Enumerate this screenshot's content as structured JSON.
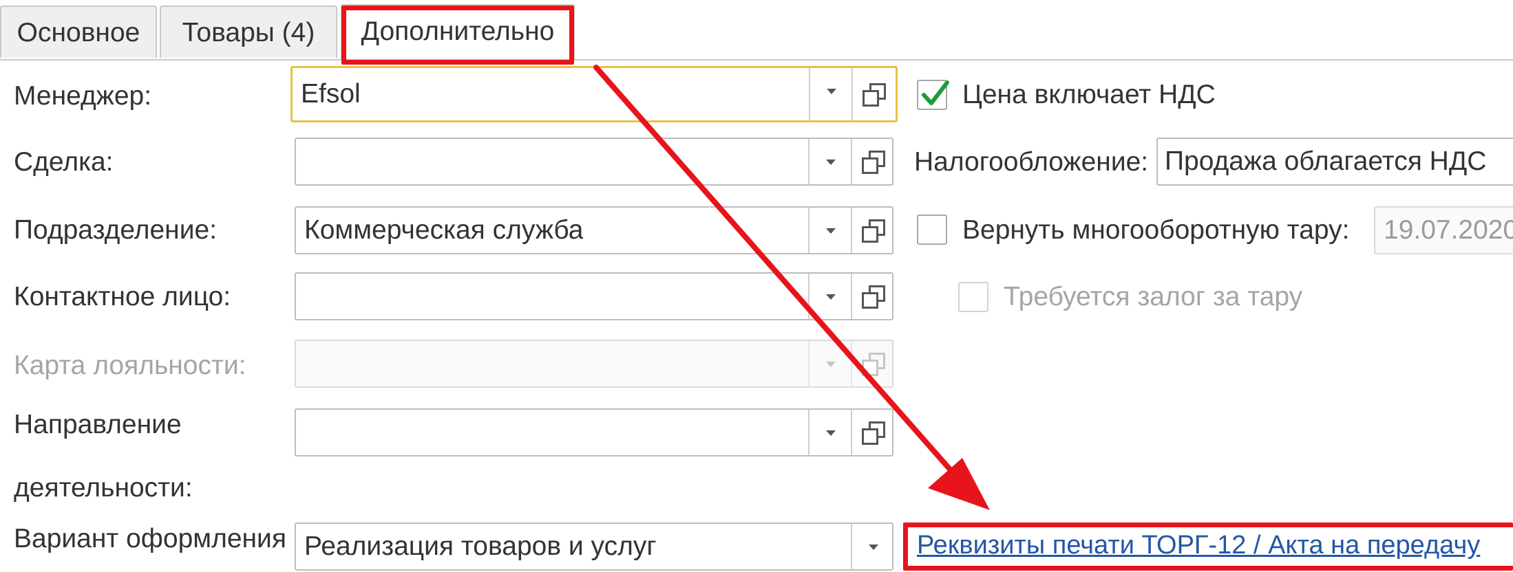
{
  "tabs": [
    {
      "label": "Основное",
      "active": false
    },
    {
      "label": "Товары (4)",
      "active": false
    },
    {
      "label": "Дополнительно",
      "active": true
    }
  ],
  "form": {
    "manager": {
      "label": "Менеджер:",
      "value": "Efsol"
    },
    "deal": {
      "label": "Сделка:",
      "value": ""
    },
    "department": {
      "label": "Подразделение:",
      "value": "Коммерческая служба"
    },
    "contact": {
      "label": "Контактное лицо:",
      "value": ""
    },
    "loyalty_card": {
      "label": "Карта лояльности:",
      "value": "",
      "disabled": true
    },
    "activity_direction": {
      "label_line1": "Направление",
      "label_line2": "деятельности:",
      "value": ""
    },
    "design_variant": {
      "label": "Вариант оформления",
      "value": "Реализация товаров и услуг"
    }
  },
  "right": {
    "price_includes_vat": {
      "label": "Цена включает НДС",
      "checked": true
    },
    "taxation": {
      "label": "Налогообложение:",
      "value": "Продажа облагается НДС"
    },
    "return_tare": {
      "label": "Вернуть многооборотную тару:",
      "checked": false,
      "date": "19.07.2020"
    },
    "tare_deposit": {
      "label": "Требуется залог за тару",
      "checked": false,
      "disabled": true
    }
  },
  "link": {
    "text": "Реквизиты печати ТОРГ-12 / Акта на передачу"
  },
  "colors": {
    "annotation_red": "#e8141c",
    "focus_yellow": "#e6c245",
    "link_blue": "#2456a6",
    "check_green": "#1a9b3a"
  },
  "icons": {
    "dropdown": "chevron-down-icon",
    "open": "open-form-icon",
    "check": "checkmark-icon"
  }
}
